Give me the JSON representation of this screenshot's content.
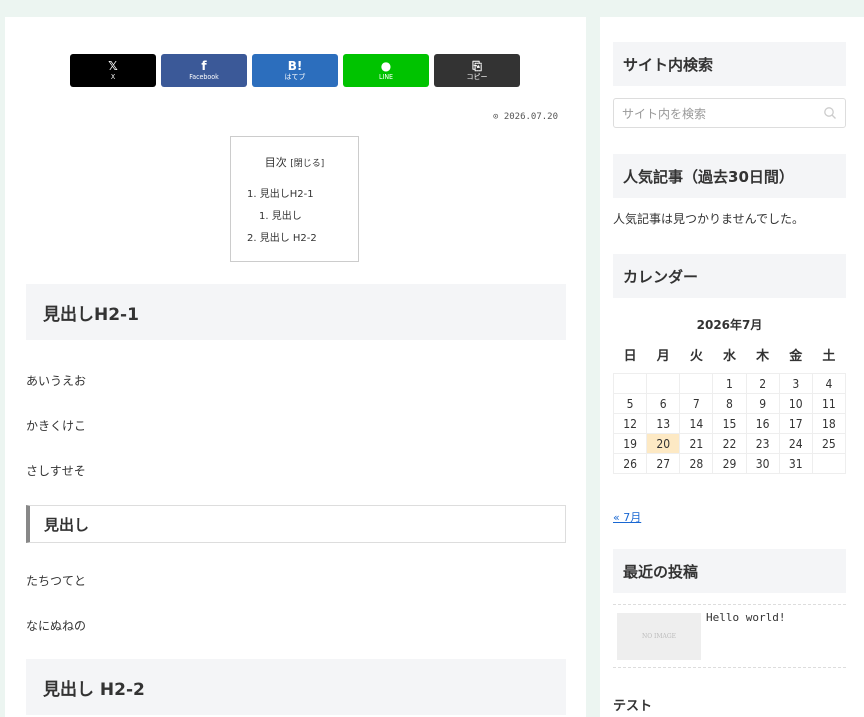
{
  "share": {
    "buttons": [
      {
        "icon": "𝕏",
        "label": "X"
      },
      {
        "icon": "f",
        "label": "Facebook"
      },
      {
        "icon": "B!",
        "label": "はてブ"
      },
      {
        "icon": "●",
        "label": "LINE"
      },
      {
        "icon": "⎘",
        "label": "コピー"
      }
    ]
  },
  "post": {
    "date": "2026.07.20",
    "toc": {
      "title": "目次",
      "toggle": "[閉じる]",
      "items": [
        "1. 見出しH2-1",
        "1. 見出し",
        "2. 見出し H2-2"
      ]
    },
    "sections": {
      "h2_1": "見出しH2-1",
      "p1": "あいうえお",
      "p2": "かきくけこ",
      "p3": "さしすせそ",
      "h3": "見出し",
      "p4": "たちつてと",
      "p5": "なにぬねの",
      "h2_2": "見出し H2-2"
    }
  },
  "sidebar": {
    "search": {
      "title": "サイト内検索",
      "placeholder": "サイト内を検索"
    },
    "popular": {
      "title": "人気記事（過去30日間）",
      "empty": "人気記事は見つかりませんでした。"
    },
    "calendar": {
      "title": "カレンダー",
      "caption": "2026年7月",
      "weekdays": [
        "日",
        "月",
        "火",
        "水",
        "木",
        "金",
        "土"
      ],
      "weeks": [
        [
          "",
          "",
          "",
          "1",
          "2",
          "3",
          "4"
        ],
        [
          "5",
          "6",
          "7",
          "8",
          "9",
          "10",
          "11"
        ],
        [
          "12",
          "13",
          "14",
          "15",
          "16",
          "17",
          "18"
        ],
        [
          "19",
          "20",
          "21",
          "22",
          "23",
          "24",
          "25"
        ],
        [
          "26",
          "27",
          "28",
          "29",
          "30",
          "31",
          ""
        ]
      ],
      "today": "20",
      "prev": "« 7月"
    },
    "recent": {
      "title": "最近の投稿",
      "noimage": "NO IMAGE",
      "post_title": "Hello world!"
    },
    "next_title": "テスト"
  }
}
